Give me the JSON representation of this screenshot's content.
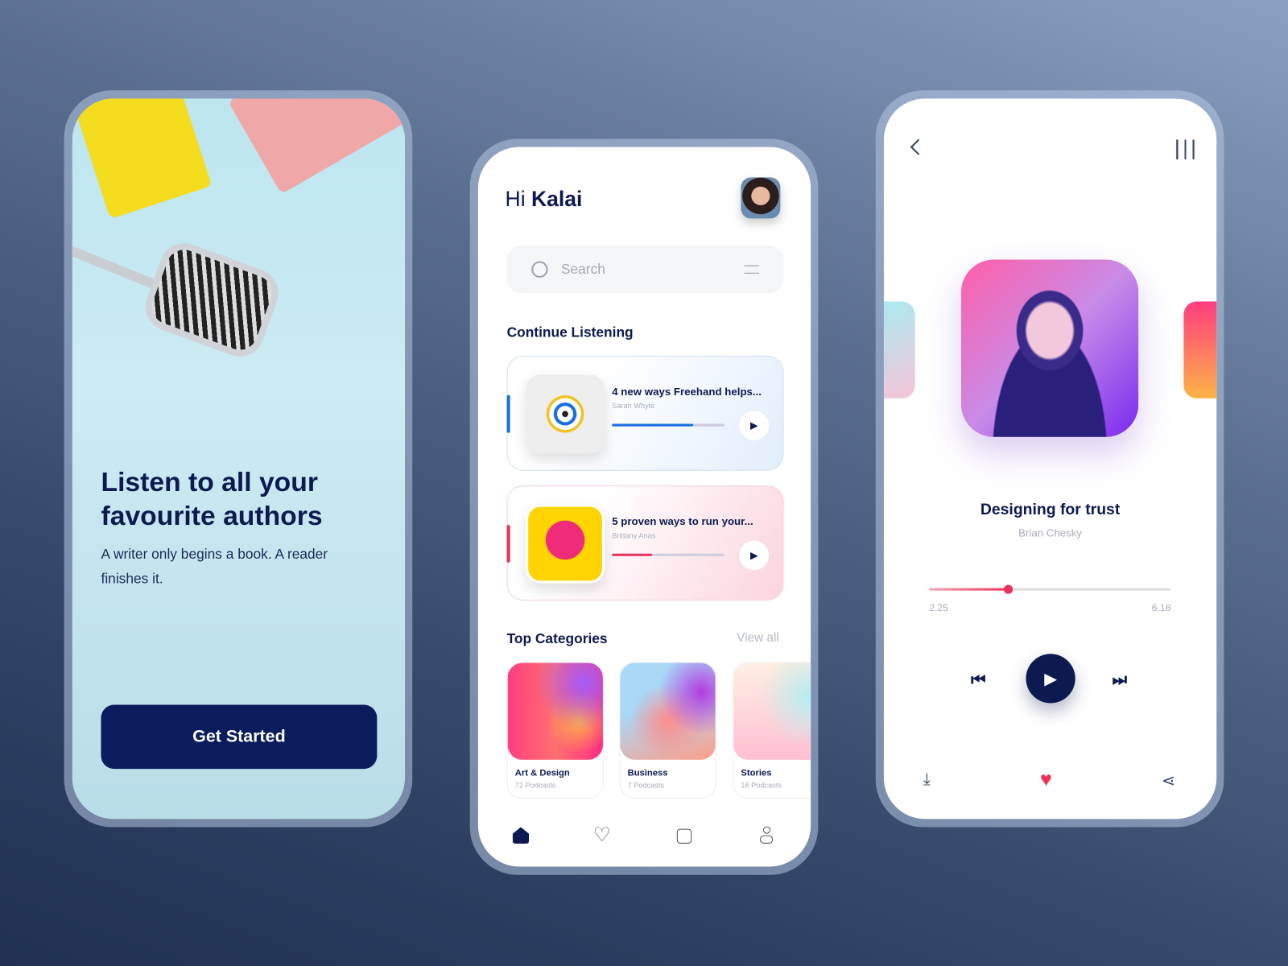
{
  "onboarding": {
    "title_line1": "Listen to all your",
    "title_line2": "favourite authors",
    "subtitle_line1": "A writer only begins a book. A reader",
    "subtitle_line2": "finishes it.",
    "cta": "Get Started"
  },
  "home": {
    "greeting": "Hi",
    "user": "Kalai",
    "search_placeholder": "Search",
    "continue_title": "Continue Listening",
    "continue": [
      {
        "title": "4 new ways Freehand helps...",
        "author": "Sarah Whyte",
        "progress": 0.72,
        "accent": "#1a6fe0"
      },
      {
        "title": "5 proven ways to run your...",
        "author": "Brittany Anas",
        "progress": 0.36,
        "accent": "#e8335a"
      }
    ],
    "categories_title": "Top Categories",
    "view_all": "View all",
    "categories": [
      {
        "name": "Art & Design",
        "count": "72 Podcasts"
      },
      {
        "name": "Business",
        "count": "7 Podcasts"
      },
      {
        "name": "Stories",
        "count": "18 Podcasts"
      }
    ],
    "nav": [
      "home-icon",
      "heart-icon",
      "bag-icon",
      "user-icon"
    ]
  },
  "player": {
    "title": "Designing for trust",
    "author": "Brian Chesky",
    "elapsed": "2.25",
    "total": "6.18",
    "progress": 0.33,
    "accent": "#e8335a",
    "navy": "#0c1a4f"
  }
}
